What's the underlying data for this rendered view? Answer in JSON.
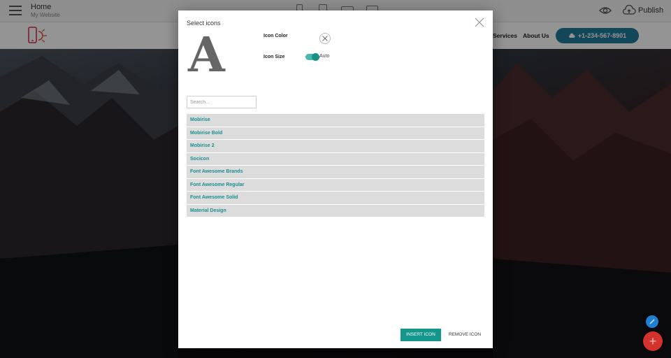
{
  "topbar": {
    "page_title": "Home",
    "page_subtitle": "My Website",
    "publish_label": "Publish"
  },
  "sitenav": {
    "services": "Services",
    "about": "About Us",
    "phone": "+1-234-567-8901"
  },
  "modal": {
    "title": "Select icons",
    "preview_glyph": "A",
    "icon_color_label": "Icon Color",
    "icon_size_label": "Icon Size",
    "size_mode": "Auto",
    "size_auto_enabled": true,
    "search_placeholder": "Search...",
    "search_value": "",
    "icon_sets": [
      "Mobirise",
      "Mobirise Bold",
      "Mobirise 2",
      "Socicon",
      "Font Awesome Brands",
      "Font Awesome Regular",
      "Font Awesome Solid",
      "Material Design"
    ],
    "insert_label": "INSERT ICON",
    "remove_label": "REMOVE ICON"
  },
  "icons": {
    "menu": "hamburger-icon",
    "devices": [
      "mobile-icon",
      "tablet-icon",
      "laptop-icon",
      "desktop-icon"
    ],
    "preview": "eye-icon",
    "publish": "cloud-upload-icon",
    "logo": "phone-sun-logo",
    "close": "close-icon",
    "edit": "pencil-icon",
    "add": "plus-icon"
  },
  "colors": {
    "accent": "#14968c",
    "set_link": "#1a8e8e",
    "phone_button": "#1f7a9c",
    "fab_add": "#d4332b",
    "fab_edit": "#1f7fd1"
  }
}
